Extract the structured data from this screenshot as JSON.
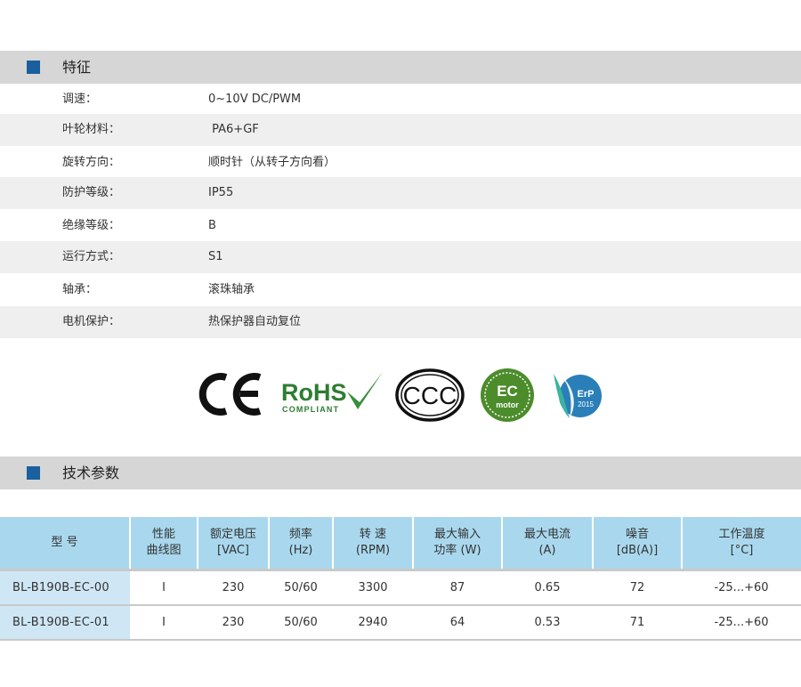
{
  "features_section": {
    "title": "特征"
  },
  "features": [
    {
      "label": "调速：",
      "value": "0~10V DC/PWM"
    },
    {
      "label": "叶轮材料：",
      "value": " PA6+GF"
    },
    {
      "label": "旋转方向：",
      "value": "顺时针（从转子方向看）"
    },
    {
      "label": "防护等级：",
      "value": "IP55"
    },
    {
      "label": "绝缘等级：",
      "value": "B"
    },
    {
      "label": "运行方式：",
      "value": "S1"
    },
    {
      "label": "轴承：",
      "value": "滚珠轴承"
    },
    {
      "label": "电机保护：",
      "value": "热保护器自动复位"
    }
  ],
  "certifications": {
    "ce": "CE",
    "rohs": {
      "main": "RoHS",
      "sub": "COMPLIANT"
    },
    "ccc": "CCC",
    "ec": {
      "main": "EC",
      "sub": "motor"
    },
    "erp": {
      "main": "ErP",
      "year": "2015"
    }
  },
  "tech_section": {
    "title": "技术参数"
  },
  "table": {
    "headers": [
      {
        "line1": "型 号",
        "line2": ""
      },
      {
        "line1": "性能",
        "line2": "曲线图"
      },
      {
        "line1": "额定电压",
        "line2": "[VAC]"
      },
      {
        "line1": "频率",
        "line2": "(Hz)"
      },
      {
        "line1": "转 速",
        "line2": "(RPM)"
      },
      {
        "line1": "最大输入",
        "line2": "功率 (W)"
      },
      {
        "line1": "最大电流",
        "line2": "(A)"
      },
      {
        "line1": "噪音",
        "line2": "[dB(A)]"
      },
      {
        "line1": "工作温度",
        "line2": "[°C]"
      }
    ],
    "rows": [
      [
        "BL-B190B-EC-00",
        "I",
        "230",
        "50/60",
        "3300",
        "87",
        "0.65",
        "72",
        "-25...+60"
      ],
      [
        "BL-B190B-EC-01",
        "I",
        "230",
        "50/60",
        "2940",
        "64",
        "0.53",
        "71",
        "-25...+60"
      ]
    ]
  },
  "colors": {
    "accent_square": "#1a5f9e",
    "bar_gray": "#d6d6d6",
    "row_shade": "#efefef",
    "table_header": "#a9d8ee",
    "model_cell": "#cfe6f4",
    "ce_black": "#111111",
    "rohs_green": "#2e7d32",
    "ec_green": "#4c8c2b",
    "erp_blue": "#2a7fb8"
  }
}
